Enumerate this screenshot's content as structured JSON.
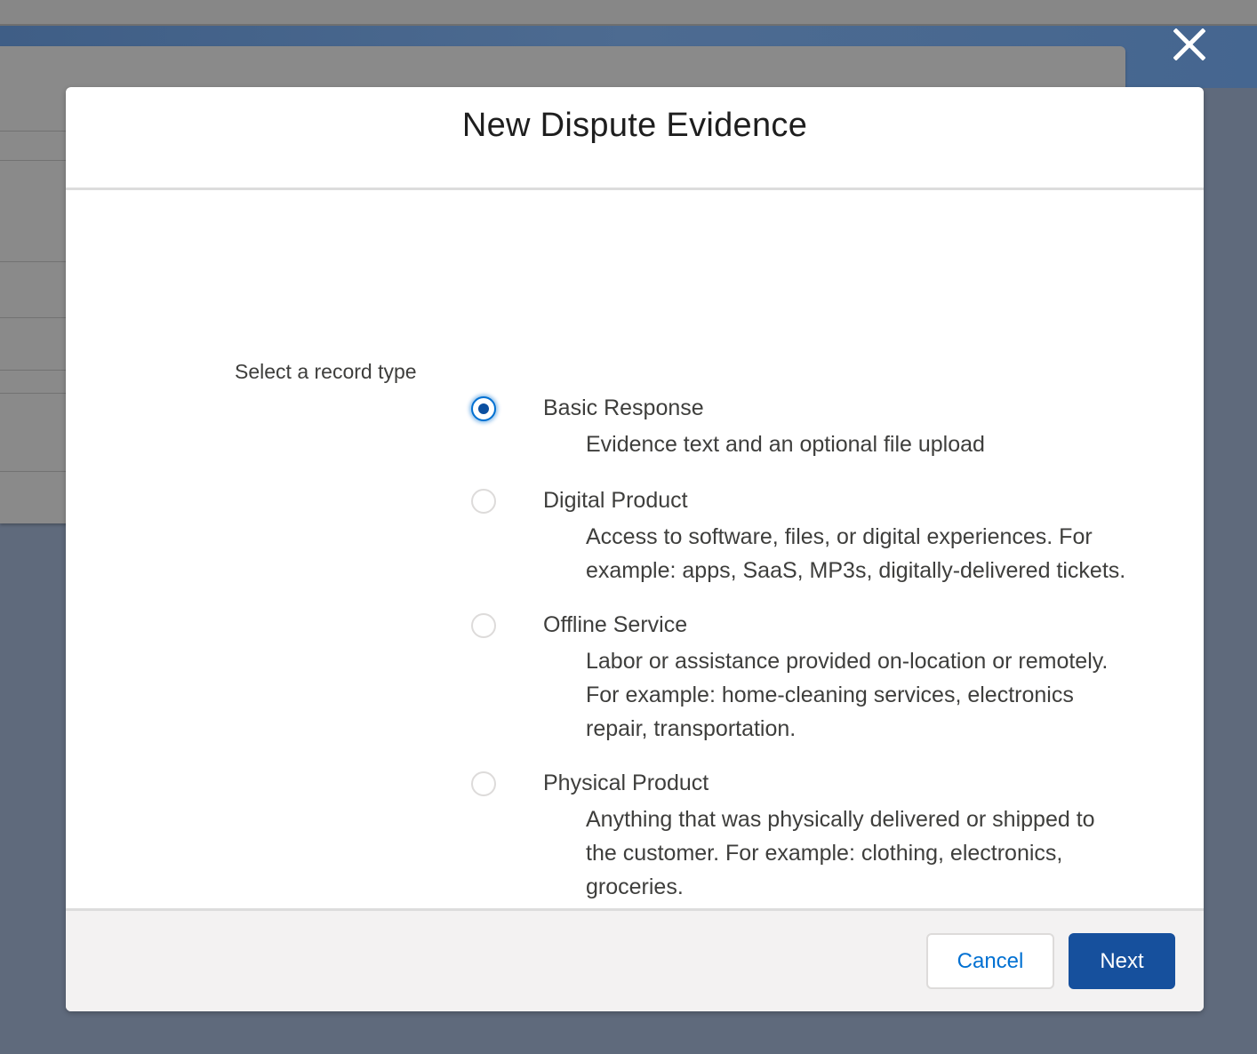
{
  "modal": {
    "title": "New Dispute Evidence",
    "group_label": "Select a record type",
    "options": [
      {
        "label": "Basic Response",
        "checked": true,
        "description": [
          "Evidence text and an optional file upload"
        ]
      },
      {
        "label": "Digital Product",
        "checked": false,
        "description": [
          "Access to software, files, or digital experiences. For",
          "example: apps, SaaS, MP3s, digitally-delivered tickets."
        ]
      },
      {
        "label": "Offline Service",
        "checked": false,
        "description": [
          "Labor or assistance provided on-location or remotely.",
          "For example: home-cleaning services, electronics",
          "repair, transportation."
        ]
      },
      {
        "label": "Physical Product",
        "checked": false,
        "description": [
          "Anything that was physically delivered or shipped to",
          "the customer. For example: clothing, electronics,",
          "groceries."
        ]
      }
    ],
    "footer": {
      "cancel_label": "Cancel",
      "next_label": "Next"
    }
  },
  "icons": {
    "close": "close-icon"
  },
  "colors": {
    "brand_blue": "#16509d",
    "link_blue": "#0070d2",
    "backdrop": "#5f6a7c"
  }
}
